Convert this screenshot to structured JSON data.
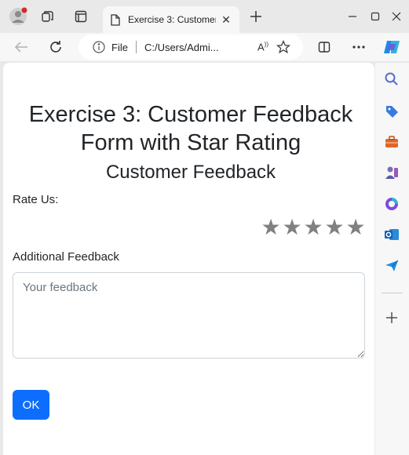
{
  "browser": {
    "tab_title": "Exercise 3: Customer",
    "address": {
      "file_label": "File",
      "url": "C:/Users/Admi..."
    }
  },
  "page": {
    "heading": "Exercise 3: Customer Feedback Form with Star Rating",
    "subheading": "Customer Feedback",
    "rate_label": "Rate Us:",
    "stars": [
      "★",
      "★",
      "★",
      "★",
      "★"
    ],
    "rating_value": 0,
    "feedback_label": "Additional Feedback",
    "feedback_placeholder": "Your feedback",
    "feedback_value": "",
    "ok_label": "OK"
  },
  "colors": {
    "accent": "#0d6efd",
    "star_inactive": "#808080",
    "chrome_bg": "#e9e9e9"
  },
  "icons": [
    "profile-icon",
    "workspaces-icon",
    "tab-actions-icon",
    "page-icon",
    "close-icon",
    "plus-icon",
    "minimize-icon",
    "maximize-icon",
    "back-icon",
    "refresh-icon",
    "info-icon",
    "read-aloud-icon",
    "favorite-icon",
    "split-screen-icon",
    "more-icon",
    "copilot-icon",
    "search-icon",
    "shopping-icon",
    "tools-icon",
    "games-icon",
    "microsoft365-icon",
    "outlook-icon",
    "send-icon"
  ]
}
